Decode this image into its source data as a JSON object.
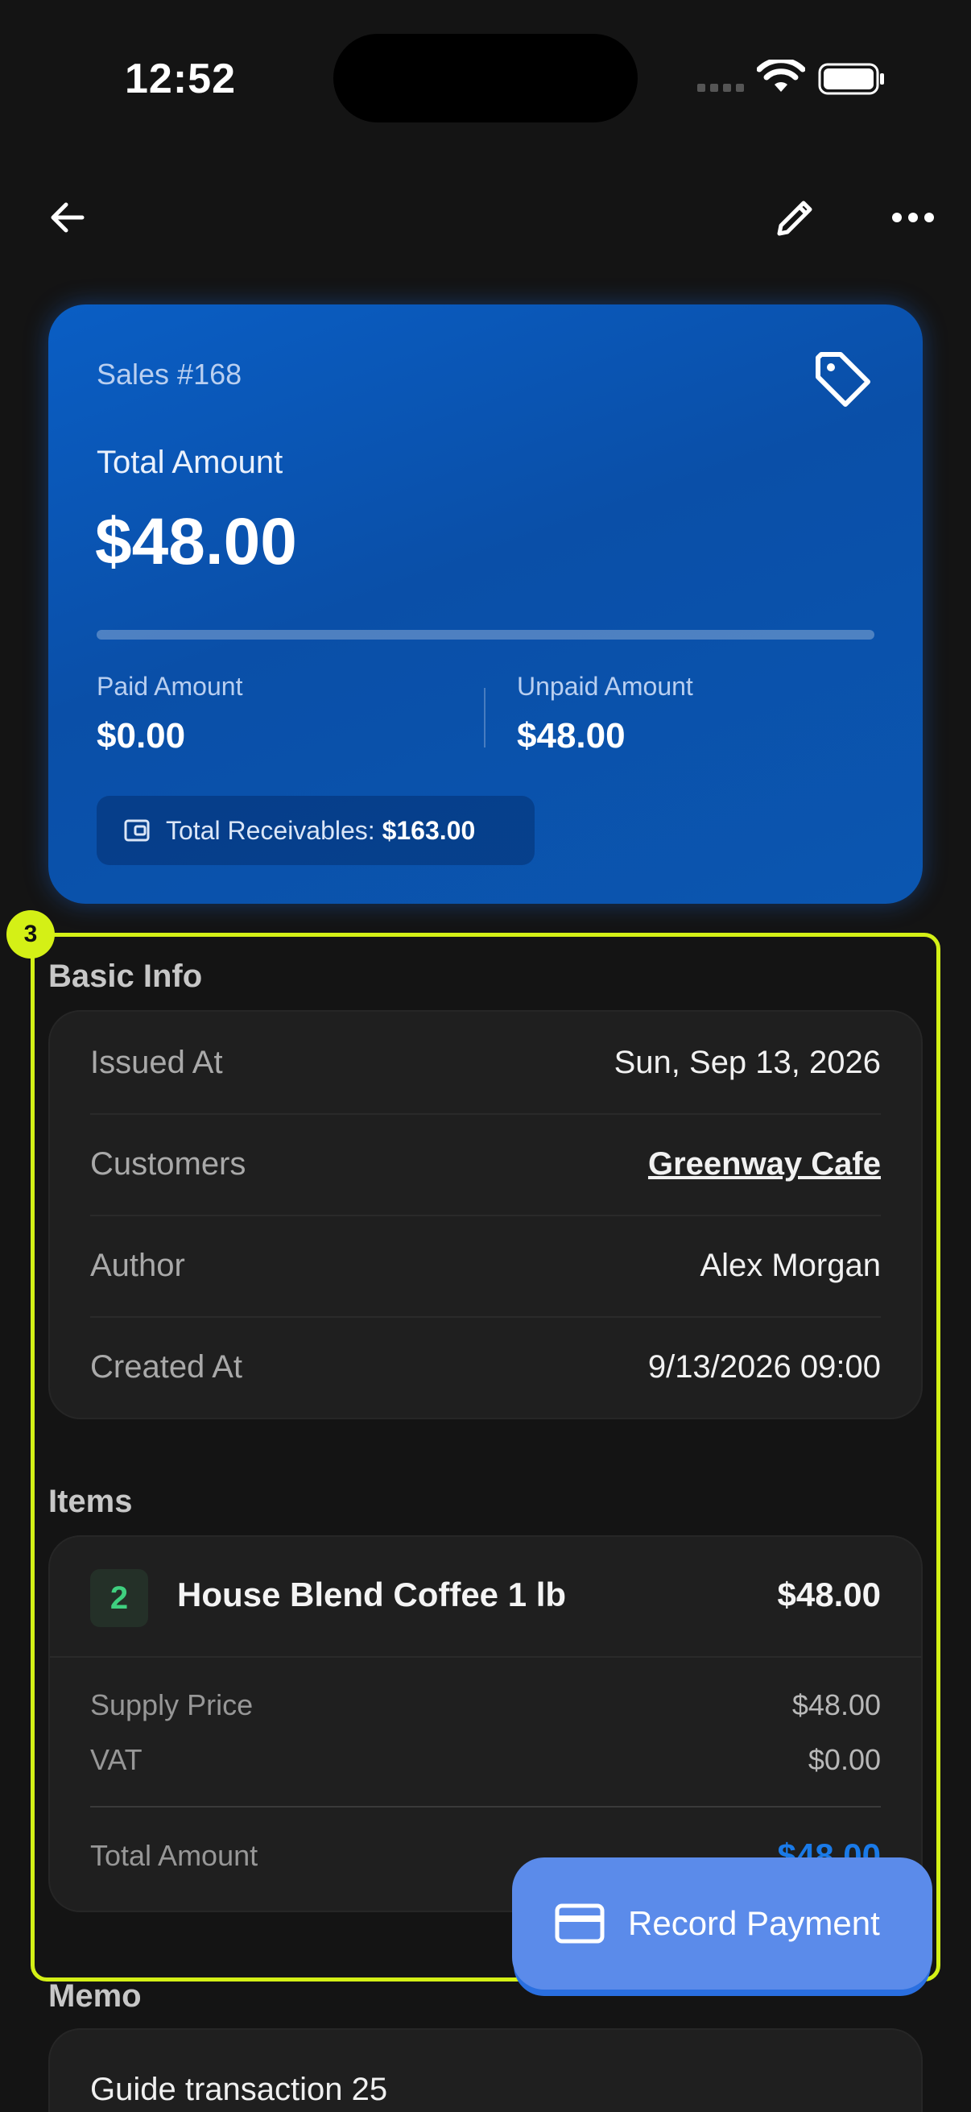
{
  "status_bar": {
    "time": "12:52"
  },
  "nav": {
    "back_icon": "arrow-left-icon",
    "edit_icon": "pencil-icon",
    "more_icon": "more-horizontal-icon"
  },
  "summary": {
    "sales_id": "Sales #168",
    "total_label": "Total Amount",
    "total_value": "$48.00",
    "paid_fraction": 0,
    "paid_label": "Paid Amount",
    "paid_value": "$0.00",
    "unpaid_label": "Unpaid Amount",
    "unpaid_value": "$48.00",
    "receivables_label": "Total Receivables:",
    "receivables_value": "$163.00"
  },
  "basic_info": {
    "title": "Basic Info",
    "rows": [
      {
        "label": "Issued At",
        "value": "Sun, Sep 13, 2026"
      },
      {
        "label": "Customers",
        "value": "Greenway Cafe"
      },
      {
        "label": "Author",
        "value": "Alex Morgan"
      },
      {
        "label": "Created At",
        "value": "9/13/2026 09:00"
      }
    ]
  },
  "items": {
    "title": "Items",
    "list": [
      {
        "quantity": "2",
        "name": "House Blend Coffee 1 lb",
        "price": "$48.00",
        "supply_price_label": "Supply Price",
        "supply_price": "$48.00",
        "vat_label": "VAT",
        "vat": "$0.00",
        "total_label": "Total Amount",
        "total": "$48.00"
      }
    ]
  },
  "memo": {
    "title": "Memo",
    "text": "Guide transaction 25"
  },
  "highlight": {
    "badge": "3"
  },
  "fab": {
    "label": "Record Payment"
  },
  "colors": {
    "card_blue": "#0a5ec4",
    "link": "#6b8ff0",
    "highlight": "#d4f016",
    "fab": "#5b8bea",
    "qty_green": "#3fcf7f"
  }
}
